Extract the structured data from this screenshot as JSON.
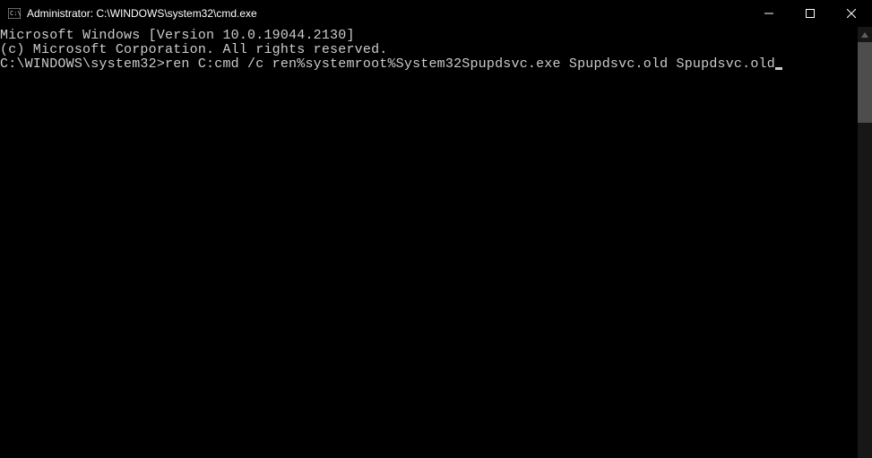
{
  "window": {
    "title": "Administrator: C:\\WINDOWS\\system32\\cmd.exe"
  },
  "terminal": {
    "line1": "Microsoft Windows [Version 10.0.19044.2130]",
    "line2": "(c) Microsoft Corporation. All rights reserved.",
    "blank": "",
    "prompt": "C:\\WINDOWS\\system32>",
    "command": "ren C:cmd /c ren%systemroot%System32Spupdsvc.exe Spupdsvc.old Spupdsvc.old"
  }
}
